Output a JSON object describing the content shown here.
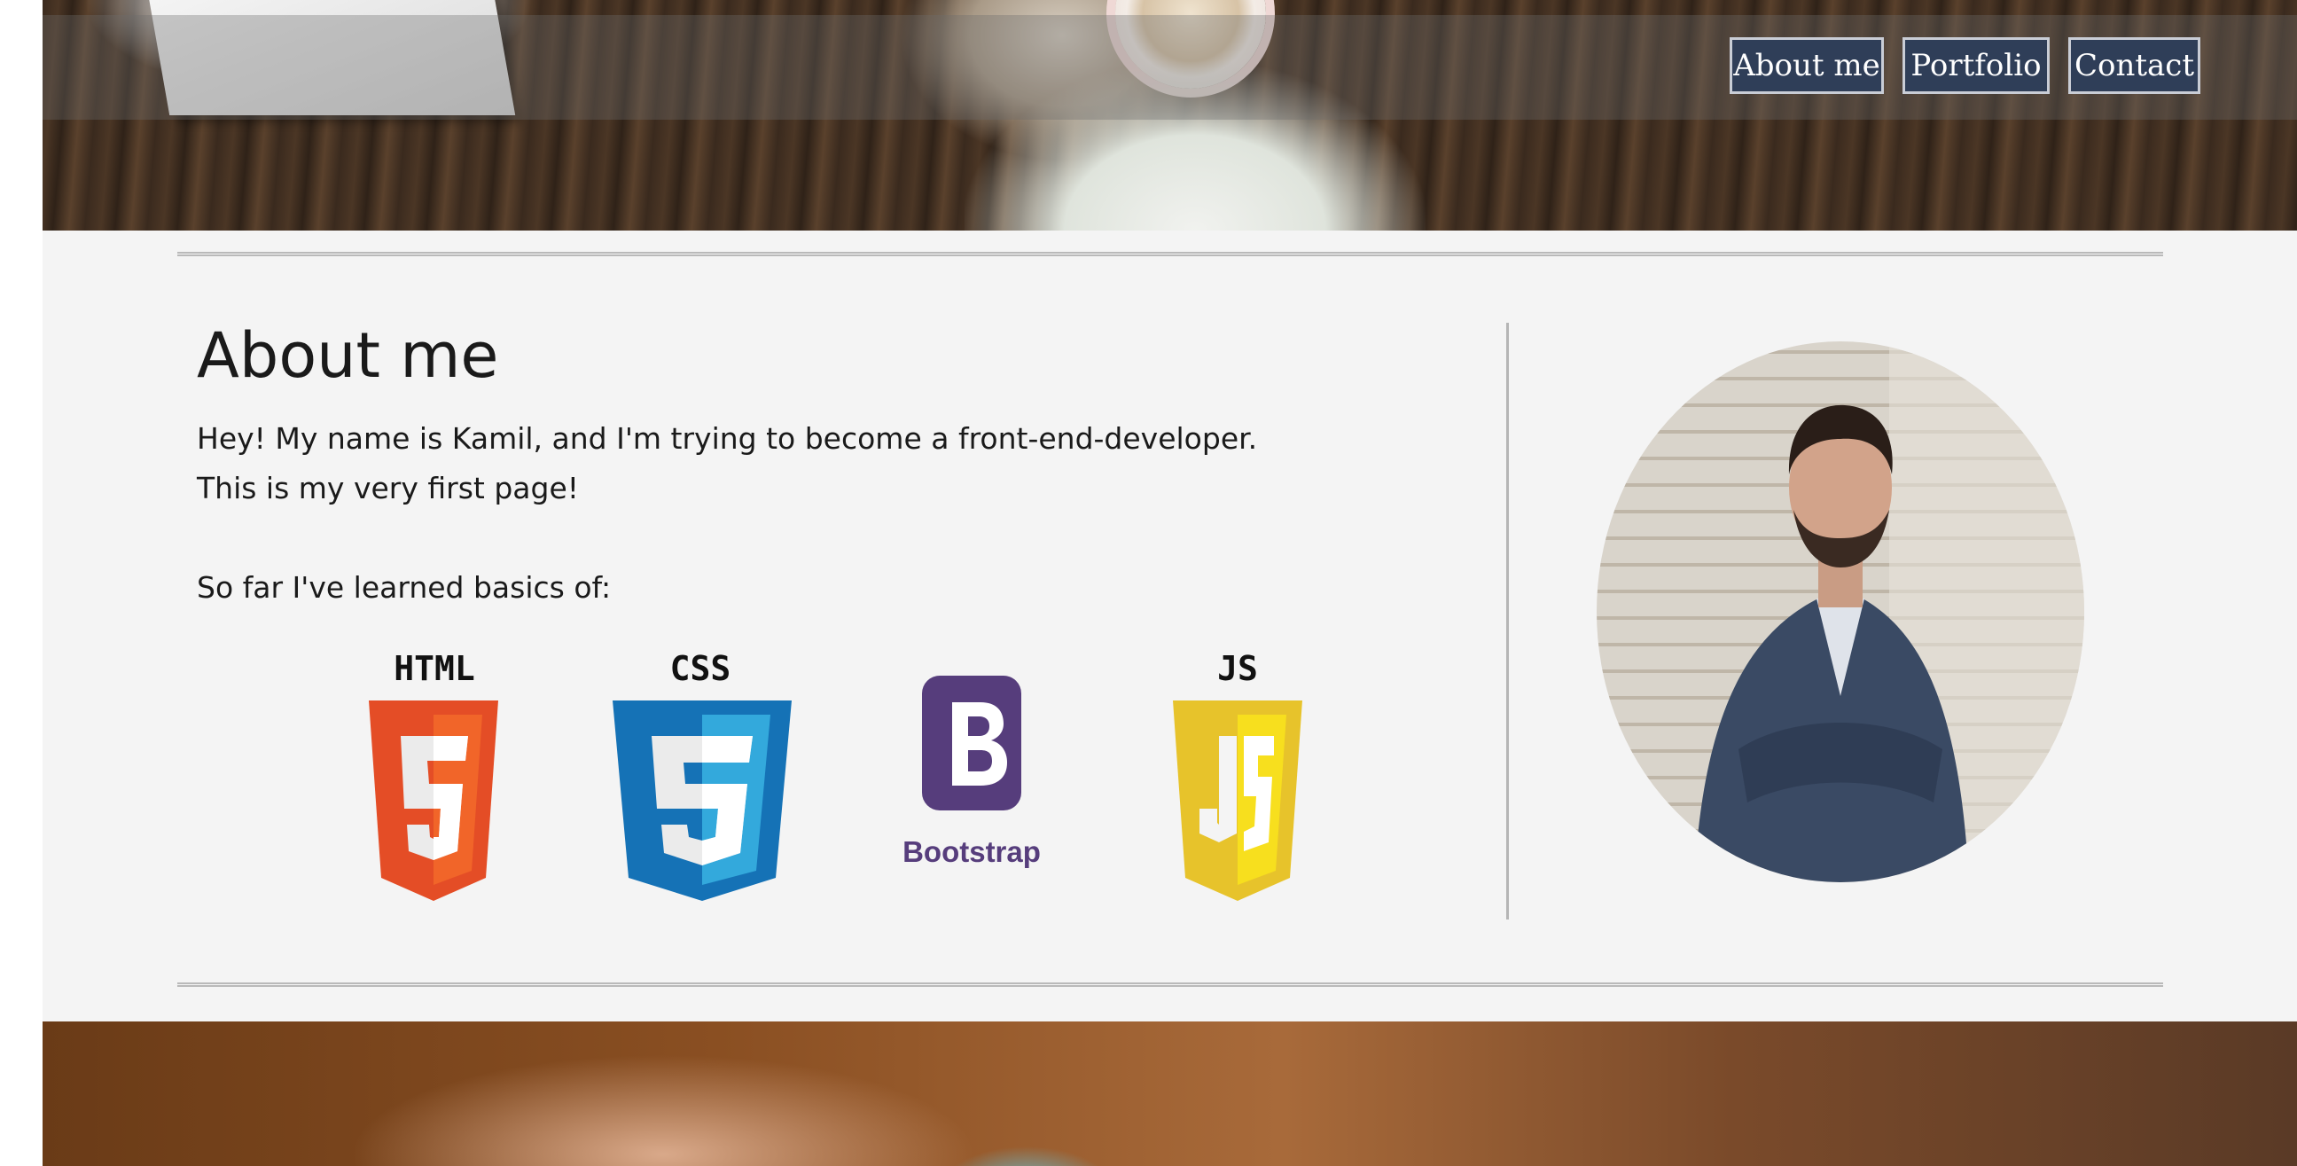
{
  "nav": {
    "items": [
      {
        "label": "About me"
      },
      {
        "label": "Portfolio"
      },
      {
        "label": "Contact"
      }
    ]
  },
  "about": {
    "title": "About me",
    "intro_line1": "Hey! My name is Kamil, and I'm trying to become a front-end-developer.",
    "intro_line2": "This is my very first page!",
    "skills_intro": "So far I've learned basics of:"
  },
  "skills": [
    {
      "label": "HTML",
      "icon": "html5-shield-icon",
      "color": "#e44d26"
    },
    {
      "label": "CSS",
      "icon": "css3-shield-icon",
      "color": "#1572b6"
    },
    {
      "label": "Bootstrap",
      "icon": "bootstrap-logo-icon",
      "color": "#563d7c"
    },
    {
      "label": "JS",
      "icon": "js-shield-icon",
      "color": "#e7c32b"
    }
  ],
  "colors": {
    "nav_button_bg": "#2f3e58",
    "section_bg": "#f4f4f4"
  }
}
